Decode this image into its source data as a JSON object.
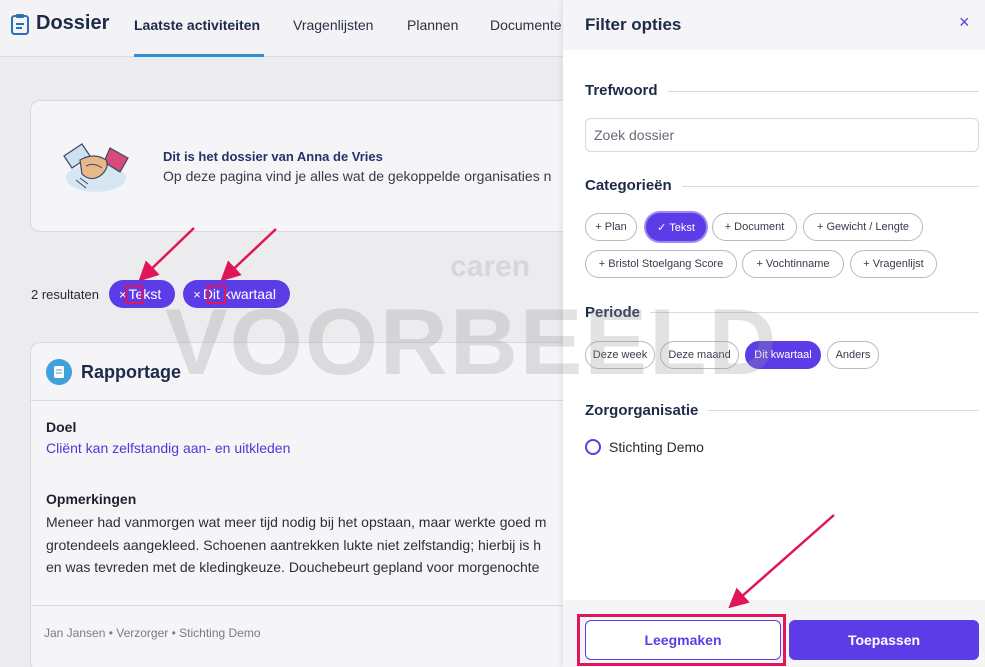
{
  "header": {
    "title": "Dossier",
    "tabs": [
      {
        "label": "Laatste activiteiten"
      },
      {
        "label": "Vragenlijsten"
      },
      {
        "label": "Plannen"
      },
      {
        "label": "Documente"
      }
    ]
  },
  "info": {
    "title": "Dit is het dossier van Anna de Vries",
    "text": "Op deze pagina vind je alles wat de gekoppelde organisaties n"
  },
  "results": {
    "count": "2 resultaten",
    "chips": [
      {
        "label": "Tekst"
      },
      {
        "label": "Dit kwartaal"
      }
    ],
    "chip_close_symbol": "×"
  },
  "report": {
    "title": "Rapportage",
    "goal_label": "Doel",
    "goal_text": "Cliënt kan zelfstandig aan- en uitkleden",
    "remarks_label": "Opmerkingen",
    "remarks_lines": [
      "Meneer had vanmorgen wat meer tijd nodig bij het opstaan, maar werkte goed m",
      "grotendeels aangekleed. Schoenen aantrekken lukte niet zelfstandig; hierbij is h",
      "en was tevreden met de kledingkeuze. Douchebeurt gepland voor morgenochte"
    ],
    "footer_meta": "Jan Jansen • Verzorger •  Stichting Demo"
  },
  "watermark": {
    "text": "VOORBEELD",
    "small_text": "caren"
  },
  "panel": {
    "title": "Filter opties",
    "close_symbol": "×",
    "keyword": {
      "title": "Trefwoord",
      "placeholder": "Zoek dossier"
    },
    "categories": {
      "title": "Categorieën",
      "items": [
        {
          "label": "+ Plan"
        },
        {
          "label": "✓ Tekst",
          "selected": true
        },
        {
          "label": "+ Document"
        },
        {
          "label": "+ Gewicht / Lengte"
        },
        {
          "label": "+ Bristol Stoelgang Score"
        },
        {
          "label": "+ Vochtinname"
        },
        {
          "label": "+ Vragenlijst"
        }
      ]
    },
    "period": {
      "title": "Periode",
      "items": [
        {
          "label": "Deze week"
        },
        {
          "label": "Deze maand"
        },
        {
          "label": "Dit kwartaal",
          "selected": true
        },
        {
          "label": "Anders"
        }
      ]
    },
    "organisation": {
      "title": "Zorgorganisatie",
      "option": "Stichting Demo"
    },
    "buttons": {
      "clear": "Leegmaken",
      "apply": "Toepassen"
    }
  },
  "colors": {
    "accent": "#5c3ce6",
    "annotation": "#e0155a",
    "tab_underline": "#2d8fd5"
  }
}
